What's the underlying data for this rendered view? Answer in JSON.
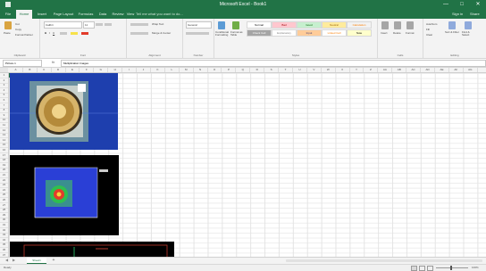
{
  "window": {
    "title": "Microsoft Excel - Book1",
    "controls": [
      "—",
      "□",
      "✕"
    ]
  },
  "ribbon_tabs": [
    {
      "label": "File",
      "active": false
    },
    {
      "label": "Home",
      "active": true
    },
    {
      "label": "Insert",
      "active": false
    },
    {
      "label": "Page Layout",
      "active": false
    },
    {
      "label": "Formulas",
      "active": false
    },
    {
      "label": "Data",
      "active": false
    },
    {
      "label": "Review",
      "active": false
    },
    {
      "label": "View",
      "active": false
    }
  ],
  "tell_me": "Tell me what you want to do...",
  "account": {
    "sign_in": "Sign in",
    "share": "Share"
  },
  "ribbon": {
    "clipboard": {
      "label": "Clipboard",
      "paste": "Paste",
      "cut": "Cut",
      "copy": "Copy",
      "format_painter": "Format Painter"
    },
    "font": {
      "label": "Font",
      "font_name": "Calibri",
      "font_size": "11"
    },
    "alignment": {
      "label": "Alignment",
      "wrap": "Wrap Text",
      "merge": "Merge & Center"
    },
    "number": {
      "label": "Number",
      "format": "General"
    },
    "styles": {
      "label": "Styles",
      "conditional": "Conditional Formatting",
      "format_table": "Format as Table",
      "cells": [
        {
          "text": "Normal",
          "bg": "#ffffff",
          "fg": "#000000"
        },
        {
          "text": "Bad",
          "bg": "#ffc7ce",
          "fg": "#9c0006"
        },
        {
          "text": "Good",
          "bg": "#c6efce",
          "fg": "#006100"
        },
        {
          "text": "Neutral",
          "bg": "#ffeb9c",
          "fg": "#9c6500"
        },
        {
          "text": "Calculation",
          "bg": "#f2f2f2",
          "fg": "#fa7d00"
        },
        {
          "text": "Check Cell",
          "bg": "#a5a5a5",
          "fg": "#ffffff"
        },
        {
          "text": "Explanatory",
          "bg": "#ffffff",
          "fg": "#7f7f7f"
        },
        {
          "text": "Input",
          "bg": "#ffcc99",
          "fg": "#3f3f76"
        },
        {
          "text": "Linked Cell",
          "bg": "#ffffff",
          "fg": "#fa7d00"
        },
        {
          "text": "Note",
          "bg": "#ffffcc",
          "fg": "#000000"
        }
      ]
    },
    "cells": {
      "label": "Cells",
      "insert": "Insert",
      "delete": "Delete",
      "format": "Format"
    },
    "editing": {
      "label": "Editing",
      "autosum": "AutoSum",
      "fill": "Fill",
      "clear": "Clear",
      "sort": "Sort & Filter",
      "find": "Find & Select"
    }
  },
  "formula_bar": {
    "name_box": "Picture 1",
    "fx": "fx",
    "value": "Multiplication Images"
  },
  "columns": [
    "A",
    "B",
    "C",
    "D",
    "E",
    "F",
    "G",
    "H",
    "I",
    "J",
    "K",
    "L",
    "M",
    "N",
    "O",
    "P",
    "Q",
    "R",
    "S",
    "T",
    "U",
    "V",
    "W",
    "X",
    "Y",
    "Z",
    "AA",
    "AB",
    "AC",
    "AD",
    "AE",
    "AF",
    "AG"
  ],
  "rows": [
    "1",
    "2",
    "3",
    "4",
    "5",
    "6",
    "7",
    "8",
    "9",
    "10",
    "11",
    "12",
    "13",
    "14",
    "15",
    "16",
    "17",
    "18",
    "19",
    "20",
    "21",
    "22",
    "23",
    "24",
    "25",
    "26",
    "27",
    "28",
    "29",
    "30",
    "31",
    "32",
    "33",
    "34",
    "35",
    "36",
    "37"
  ],
  "cell_a1": "Multi Image",
  "sheet": {
    "tab": "Sheet1",
    "add": "+"
  },
  "status": {
    "ready": "Ready",
    "zoom": "100%"
  }
}
